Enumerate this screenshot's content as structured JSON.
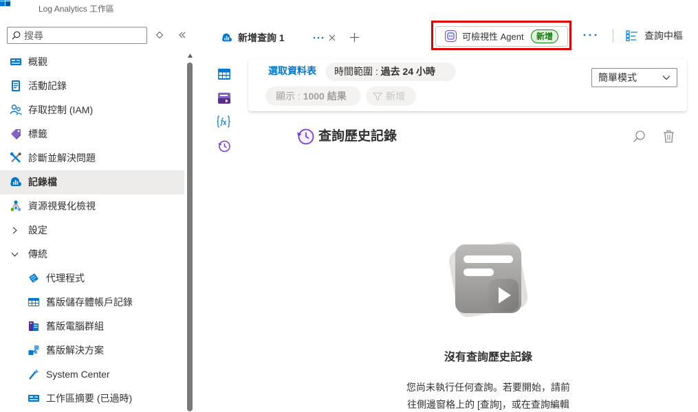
{
  "header": {
    "subtitle": "Log Analytics 工作區",
    "logo_icon": "log-analytics-workspace-icon"
  },
  "sidebar": {
    "search": {
      "placeholder": "搜尋",
      "icon": "search-icon"
    },
    "expand_collapse_icon": "diamond-expand-icon",
    "collapse_icon": "double-chevron-left-icon",
    "items": [
      {
        "label": "概觀",
        "icon": "overview-icon"
      },
      {
        "label": "活動記錄",
        "icon": "activity-log-icon"
      },
      {
        "label": "存取控制 (IAM)",
        "icon": "access-control-icon"
      },
      {
        "label": "標籤",
        "icon": "tag-icon"
      },
      {
        "label": "診斷並解決問題",
        "icon": "wrench-icon"
      },
      {
        "label": "記錄檔",
        "icon": "logs-icon",
        "selected": true
      },
      {
        "label": "資源視覺化檢視",
        "icon": "resource-visualizer-icon"
      },
      {
        "label": "設定",
        "state": "collapsed",
        "icon": "chevron-right-icon"
      },
      {
        "label": "傳統",
        "state": "expanded",
        "icon": "chevron-down-icon"
      }
    ],
    "legacy_items": [
      {
        "label": "代理程式",
        "icon": "agents-icon"
      },
      {
        "label": "舊版儲存體帳戶記錄",
        "icon": "storage-table-icon"
      },
      {
        "label": "舊版電腦群組",
        "icon": "computer-groups-icon"
      },
      {
        "label": "舊版解決方案",
        "icon": "solutions-icon"
      },
      {
        "label": "System Center",
        "icon": "system-center-icon"
      },
      {
        "label": "工作區摘要 (已過時)",
        "icon": "workspace-summary-icon"
      }
    ]
  },
  "tabs": {
    "items": [
      {
        "label": "新增查詢 1",
        "icon": "logs-icon",
        "active": true
      }
    ],
    "more_icon": "more-dots-icon",
    "close_icon": "close-icon",
    "add_icon": "plus-icon"
  },
  "toolbar": {
    "agent_button": {
      "label": "可檢視性 Agent",
      "badge": "新增",
      "icon": "agent-icon",
      "highlighted": true
    },
    "more_icon": "more-dots-icon",
    "query_hub": {
      "label": "查詢中樞",
      "icon": "query-hub-icon"
    }
  },
  "side_pane_icons": [
    "tables-icon",
    "queries-icon",
    "functions-icon",
    "query-history-icon"
  ],
  "query_bar": {
    "select_table": "選取資料表",
    "time_range_label": "時間範圍 : ",
    "time_range_value": "過去 24 小時",
    "mode": "簡單模式",
    "show_label": "顯示 : ",
    "show_value": "1000 結果",
    "add_filter": "新增"
  },
  "history": {
    "title": "查詢歷史記錄",
    "empty_title": "沒有查詢歷史記錄",
    "empty_line1": "您尚未執行任何查詢。若要開始，請前",
    "empty_line2": "往側邊窗格上的 [查詢]，或在查詢編輯"
  },
  "colors": {
    "accent": "#0078d4",
    "highlight_border": "#e00000",
    "badge_bg": "#dff6dd",
    "badge_text": "#107c10",
    "selected_bg": "#edebe9",
    "history_purple": "#773adc"
  }
}
